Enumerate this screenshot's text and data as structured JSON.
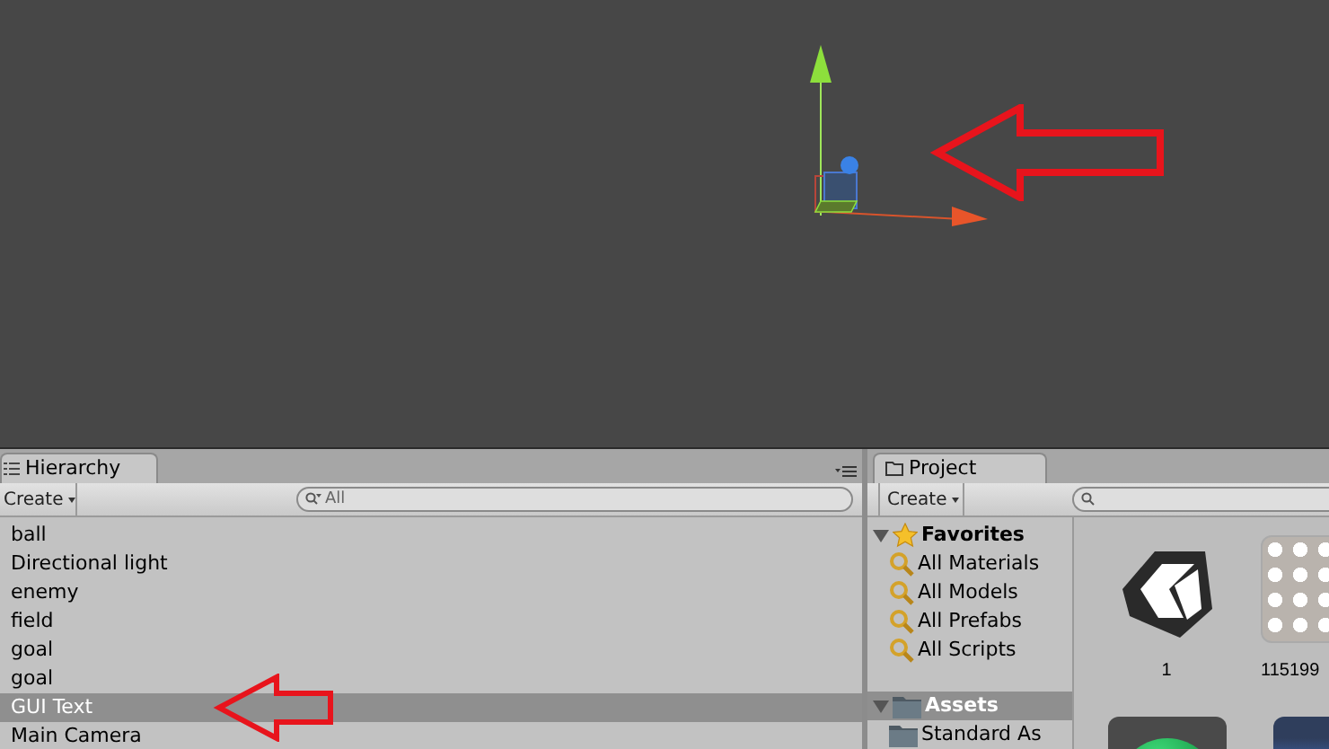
{
  "hierarchy": {
    "tab": "Hierarchy",
    "create": "Create",
    "search_placeholder": "All",
    "items": [
      {
        "label": "ball",
        "selected": false
      },
      {
        "label": "Directional light",
        "selected": false
      },
      {
        "label": "enemy",
        "selected": false
      },
      {
        "label": "field",
        "selected": false
      },
      {
        "label": "goal",
        "selected": false
      },
      {
        "label": "goal",
        "selected": false
      },
      {
        "label": "GUI Text",
        "selected": true
      },
      {
        "label": "Main Camera",
        "selected": false
      }
    ]
  },
  "project": {
    "tab": "Project",
    "create": "Create",
    "tree": [
      {
        "label": "Favorites",
        "kind": "favorites",
        "expanded": true,
        "selected": false,
        "children": [
          {
            "label": "All Materials",
            "kind": "search",
            "selected": false
          },
          {
            "label": "All Models",
            "kind": "search",
            "selected": false
          },
          {
            "label": "All Prefabs",
            "kind": "search",
            "selected": false
          },
          {
            "label": "All Scripts",
            "kind": "search",
            "selected": false
          }
        ]
      },
      {
        "label": "Assets",
        "kind": "folder",
        "expanded": true,
        "selected": true,
        "children": [
          {
            "label": "Standard As",
            "kind": "folder",
            "selected": false
          }
        ]
      }
    ],
    "assets": [
      {
        "label": "1",
        "kind": "unity-logo"
      },
      {
        "label": "115199",
        "kind": "texture"
      },
      {
        "kind": "sphere"
      },
      {
        "kind": "water"
      }
    ]
  }
}
